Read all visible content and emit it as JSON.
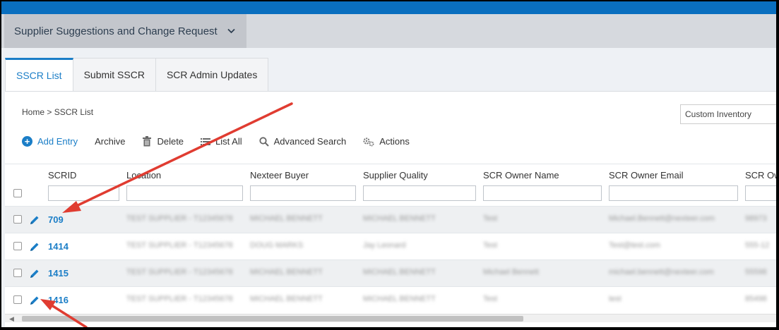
{
  "module": {
    "title": "Supplier Suggestions and Change Request",
    "icon": "chevron-down-icon"
  },
  "tabs": [
    {
      "label": "SSCR List",
      "active": true
    },
    {
      "label": "Submit SSCR",
      "active": false
    },
    {
      "label": "SCR Admin Updates",
      "active": false
    }
  ],
  "breadcrumb": {
    "home": "Home",
    "separator": ">",
    "current": "SSCR List"
  },
  "view_select": {
    "value": "Custom Inventory"
  },
  "toolbar": {
    "add_entry": "Add Entry",
    "archive": "Archive",
    "delete": "Delete",
    "list_all": "List All",
    "advanced_search": "Advanced Search",
    "actions": "Actions"
  },
  "columns": [
    "SCRID",
    "Location",
    "Nexteer Buyer",
    "Supplier Quality",
    "SCR Owner Name",
    "SCR Owner Email",
    "SCR Ow"
  ],
  "rows": [
    {
      "scrid": "709",
      "location": "TEST SUPPLIER - T12345678",
      "buyer": "MICHAEL BENNETT",
      "quality": "MICHAEL BENNETT",
      "owner": "Test",
      "email": "Michael.Bennett@nexteer.com",
      "extra": "98973"
    },
    {
      "scrid": "1414",
      "location": "TEST SUPPLIER - T12345678",
      "buyer": "DOUG MARKS",
      "quality": "Jay Leonard",
      "owner": "Test",
      "email": "Test@test.com",
      "extra": "555-12"
    },
    {
      "scrid": "1415",
      "location": "TEST SUPPLIER - T12345678",
      "buyer": "MICHAEL BENNETT",
      "quality": "MICHAEL BENNETT",
      "owner": "Michael Bennett",
      "email": "michael.bennett@nexteer.com",
      "extra": "55598"
    },
    {
      "scrid": "1416",
      "location": "TEST SUPPLIER - T12345678",
      "buyer": "MICHAEL BENNETT",
      "quality": "MICHAEL BENNETT",
      "owner": "Test",
      "email": "test",
      "extra": "85498"
    }
  ],
  "colors": {
    "accent": "#1b7ec7",
    "topbar": "#0a6fbf",
    "annotation": "#e03c31"
  }
}
